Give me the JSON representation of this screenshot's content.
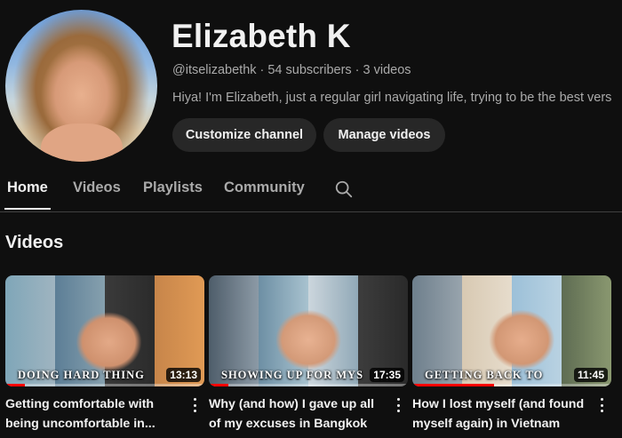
{
  "channel": {
    "name": "Elizabeth K",
    "handle": "@itselizabethk",
    "subscribers": "54 subscribers",
    "video_count": "3 videos",
    "separator": "·",
    "bio": "Hiya! I'm Elizabeth, just a regular girl navigating life, trying to be the best vers"
  },
  "buttons": {
    "customize": "Customize channel",
    "manage": "Manage videos"
  },
  "tabs": [
    {
      "label": "Home",
      "active": true
    },
    {
      "label": "Videos",
      "active": false
    },
    {
      "label": "Playlists",
      "active": false
    },
    {
      "label": "Community",
      "active": false
    }
  ],
  "section": {
    "title": "Videos"
  },
  "videos": [
    {
      "thumbnail_caption": "DOING HARD THING",
      "duration": "13:13",
      "title": "Getting comfortable with being uncomfortable in...",
      "watch_progress": 0.1
    },
    {
      "thumbnail_caption": "SHOWING UP FOR MYS",
      "duration": "17:35",
      "title": "Why (and how) I gave up all of my excuses in Bangkok",
      "watch_progress": 0.1
    },
    {
      "thumbnail_caption": "GETTING BACK TO",
      "duration": "11:45",
      "title": "How I lost myself (and found myself again) in Vietnam",
      "watch_progress": 0.41
    }
  ],
  "icons": {
    "search": "search-icon",
    "more": "more-vert-icon"
  },
  "colors": {
    "background": "#0f0f0f",
    "button": "#272727",
    "progress": "#ff0000",
    "secondary_text": "#aaaaaa"
  }
}
